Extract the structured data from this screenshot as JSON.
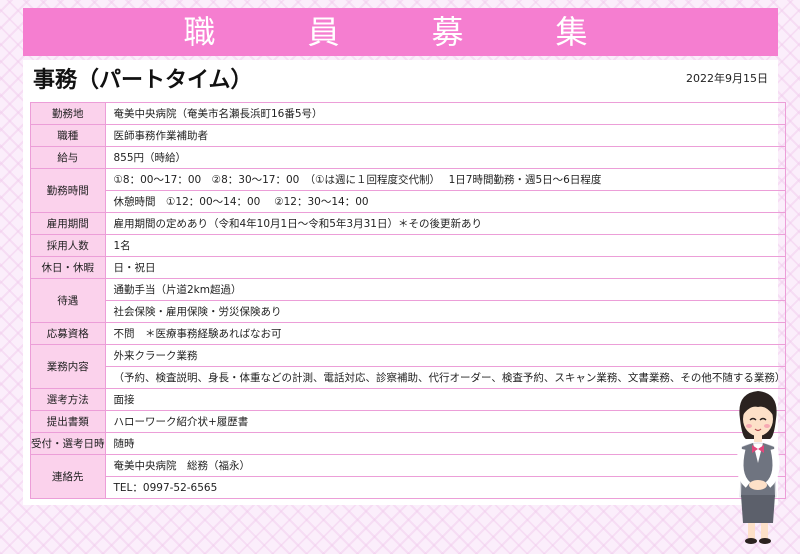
{
  "header": {
    "title": "職　員　募　集"
  },
  "job": {
    "title": "事務（パートタイム）",
    "date": "2022年9月15日"
  },
  "rows": {
    "location": {
      "label": "勤務地",
      "value": "奄美中央病院（奄美市名瀬長浜町16番5号）"
    },
    "position": {
      "label": "職種",
      "value": "医師事務作業補助者"
    },
    "salary": {
      "label": "給与",
      "value": "855円（時給）"
    },
    "hours": {
      "label": "勤務時間",
      "line1": "①8：00〜17：00　②8：30〜17：00　（①は週に１回程度交代制）　 1日7時間勤務・週5日〜6日程度",
      "line2": "休憩時間　①12：00〜14：00　 ②12：30〜14：00"
    },
    "period": {
      "label": "雇用期間",
      "value": "雇用期間の定めあり（令和4年10月1日〜令和5年3月31日）＊その後更新あり"
    },
    "headcount": {
      "label": "採用人数",
      "value": "1名"
    },
    "holidays": {
      "label": "休日・休暇",
      "value": "日・祝日"
    },
    "benefits": {
      "label": "待遇",
      "line1": "通勤手当（片道2km超過）",
      "line2": "社会保険・雇用保険・労災保険あり"
    },
    "qualification": {
      "label": "応募資格",
      "value": "不問　＊医療事務経験あればなお可"
    },
    "duties": {
      "label": "業務内容",
      "line1": "外来クラーク業務",
      "line2": "（予約、検査説明、身長・体重などの計測、電話対応、診察補助、代行オーダー、検査予約、スキャン業務、文書業務、その他不随する業務）"
    },
    "selection": {
      "label": "選考方法",
      "value": "面接"
    },
    "documents": {
      "label": "提出書類",
      "value": "ハローワーク紹介状+履歴書"
    },
    "schedule": {
      "label": "受付・選考日時",
      "value": "随時"
    },
    "contact": {
      "label": "連絡先",
      "line1": "奄美中央病院　総務（福永）",
      "line2": "TEL：0997-52-6565"
    }
  }
}
